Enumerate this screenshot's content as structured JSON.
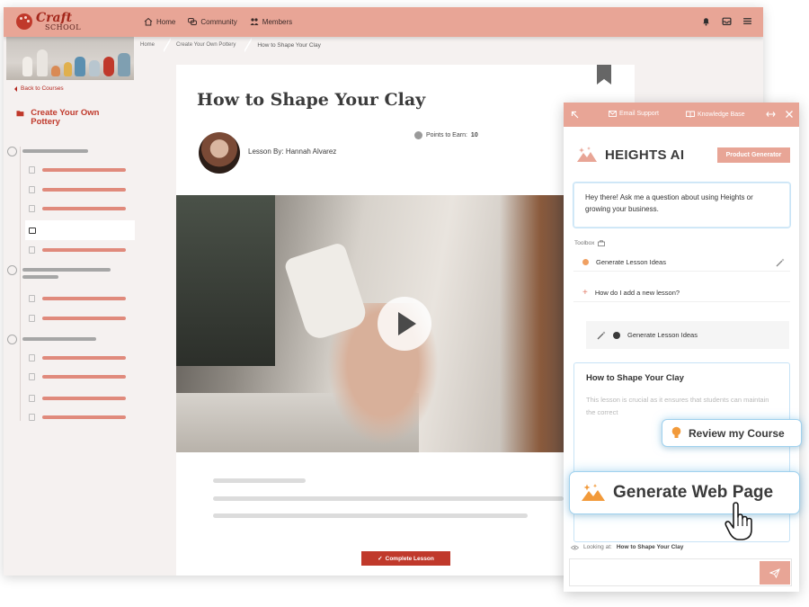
{
  "app": {
    "logo": {
      "craft": "Craft",
      "school": "SCHOOL"
    },
    "nav": {
      "home": "Home",
      "community": "Community",
      "members": "Members"
    },
    "icons": {
      "bell": "bell-icon",
      "inbox": "inbox-icon",
      "menu": "menu-icon"
    }
  },
  "sidebar": {
    "back": "Back to Courses",
    "course_title": "Create Your Own Pottery"
  },
  "breadcrumb": {
    "home": "Home",
    "course": "Create Your Own Pottery",
    "current": "How to Shape Your Clay"
  },
  "lesson": {
    "title": "How to Shape Your Clay",
    "author_prefix": "Lesson By:",
    "author": "Hannah Alvarez",
    "points_label": "Points to Earn:",
    "points_value": "10",
    "complete_label": "Complete Lesson"
  },
  "ai": {
    "email_support": "Email Support",
    "knowledge_base": "Knowledge Base",
    "brand": "HEIGHTS AI",
    "product_generator": "Product Generator",
    "greeting": "Hey there! Ask me a question about using Heights or growing your business.",
    "toolbox_label": "Toolbox",
    "tool_1": "Generate Lesson Ideas",
    "tool_2": "How do I add a new lesson?",
    "generate_row": "Generate Lesson Ideas",
    "result_title": "How to Shape Your Clay",
    "result_body": "This lesson is crucial as it ensures that students can maintain the correct",
    "looking_prefix": "Looking at:",
    "looking_value": "How to Shape Your Clay"
  },
  "floating": {
    "review": "Review my Course",
    "generate": "Generate Web Page"
  },
  "colors": {
    "brand": "#e8a596",
    "accent": "#c0392b",
    "lesson_bar": "#e08a7c",
    "glow": "#9fd1ee"
  }
}
